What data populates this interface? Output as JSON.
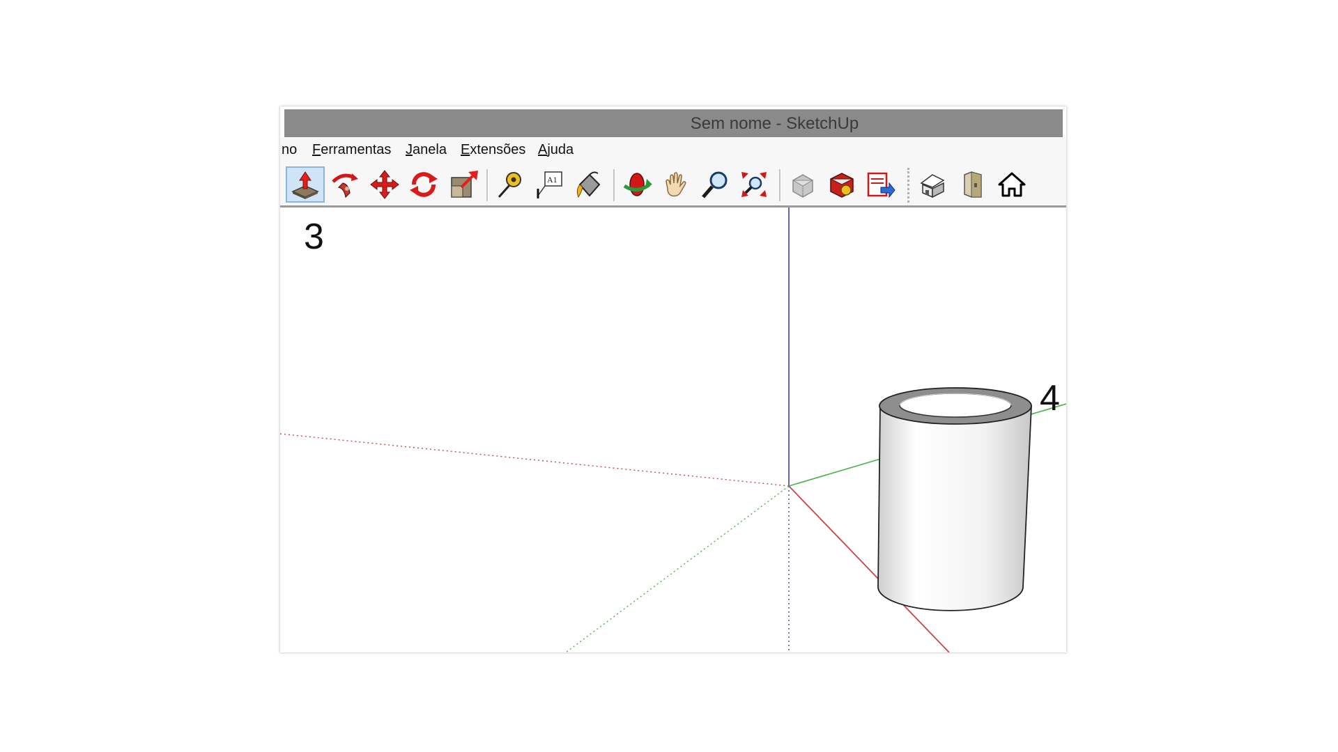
{
  "window": {
    "title": "Sem nome - SketchUp"
  },
  "menu": {
    "items": [
      {
        "label": "no"
      },
      {
        "label": "Ferramentas"
      },
      {
        "label": "Janela"
      },
      {
        "label": "Extensões"
      },
      {
        "label": "Ajuda"
      }
    ]
  },
  "toolbar": {
    "tools": [
      {
        "name": "push-pull-tool",
        "icon": "push-pull-icon",
        "active": true
      },
      {
        "name": "follow-me-tool",
        "icon": "follow-me-icon"
      },
      {
        "name": "move-tool",
        "icon": "move-icon"
      },
      {
        "name": "rotate-tool",
        "icon": "rotate-icon"
      },
      {
        "name": "scale-tool",
        "icon": "scale-icon"
      },
      {
        "name": "tape-measure-tool",
        "icon": "tape-measure-icon"
      },
      {
        "name": "text-tool",
        "icon": "text-icon",
        "text": "A1"
      },
      {
        "name": "paint-bucket-tool",
        "icon": "paint-bucket-icon"
      },
      {
        "name": "orbit-tool",
        "icon": "orbit-icon"
      },
      {
        "name": "pan-tool",
        "icon": "pan-hand-icon"
      },
      {
        "name": "zoom-tool",
        "icon": "zoom-magnifier-icon"
      },
      {
        "name": "zoom-extents-tool",
        "icon": "zoom-extents-icon"
      },
      {
        "name": "warehouse-tool",
        "icon": "warehouse-icon"
      },
      {
        "name": "extension-warehouse-tool",
        "icon": "extension-warehouse-icon"
      },
      {
        "name": "send-to-layout-tool",
        "icon": "send-to-layout-icon"
      },
      {
        "name": "iso-view",
        "icon": "house-iso-icon"
      },
      {
        "name": "front-view",
        "icon": "front-view-icon"
      },
      {
        "name": "home-view",
        "icon": "home-icon"
      }
    ]
  },
  "annotations": {
    "step_3": "3",
    "step_4": "4"
  },
  "colors": {
    "titlebar": "#8a8a8a",
    "blue_axis": "#3c3cb4",
    "red_axis": "#c84646",
    "green_axis": "#46b446",
    "active_tool": "#cfe4f7"
  }
}
